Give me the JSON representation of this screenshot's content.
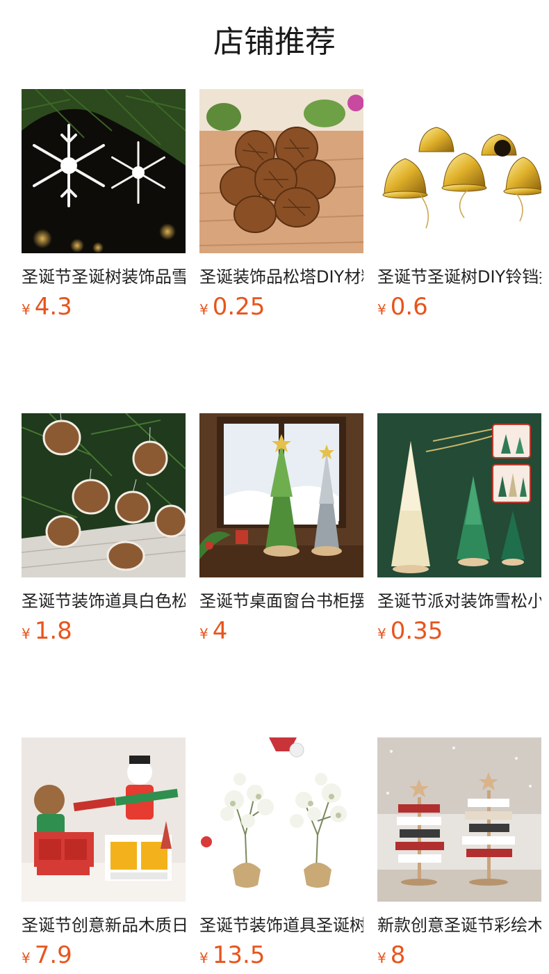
{
  "header": {
    "title": "店铺推荐"
  },
  "currency_symbol": "¥",
  "products": [
    {
      "name": "圣诞节圣诞树装饰品雪花挂件",
      "price": "4.3",
      "image": "snowflake-ornaments"
    },
    {
      "name": "圣诞装饰品松塔DIY材料",
      "price": "0.25",
      "image": "pinecones"
    },
    {
      "name": "圣诞节圣诞树DIY铃铛挂件",
      "price": "0.6",
      "image": "golden-bells"
    },
    {
      "name": "圣诞节装饰道具白色松果挂件",
      "price": "1.8",
      "image": "snowy-pinecones"
    },
    {
      "name": "圣诞节桌面窗台书柜摆件",
      "price": "4",
      "image": "mini-trees-window"
    },
    {
      "name": "圣诞节派对装饰雪松小树",
      "price": "0.35",
      "image": "sisal-trees"
    },
    {
      "name": "圣诞节创意新品木质日历",
      "price": "7.9",
      "image": "wooden-calendar"
    },
    {
      "name": "圣诞节装饰道具圣诞树盆栽",
      "price": "13.5",
      "image": "snowy-plants"
    },
    {
      "name": "新款创意圣诞节彩绘木质摆件",
      "price": "8",
      "image": "wooden-signpost-trees"
    }
  ]
}
